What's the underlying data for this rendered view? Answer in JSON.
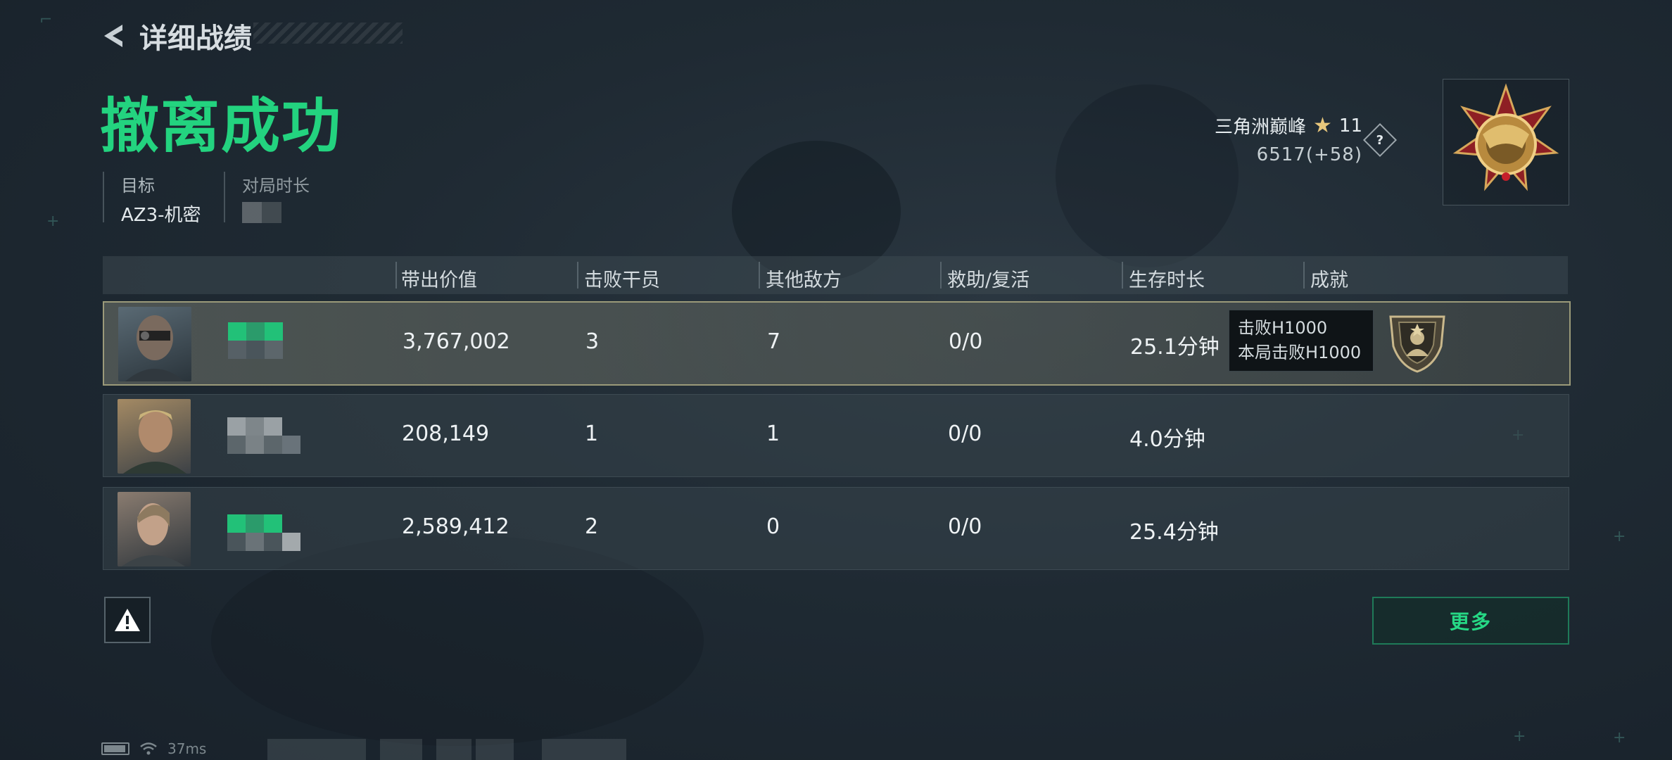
{
  "header": {
    "back_title": "详细战绩"
  },
  "result_title": "撤离成功",
  "info": {
    "target_label": "目标",
    "target_value": "AZ3-机密",
    "duration_label": "对局时长"
  },
  "rank": {
    "name": "三角洲巅峰",
    "stars": "11",
    "score": "6517(+58)",
    "help": "?"
  },
  "table": {
    "columns": [
      "带出价值",
      "击败干员",
      "其他敌方",
      "救助/复活",
      "生存时长",
      "成就"
    ],
    "rows": [
      {
        "value": "3,767,002",
        "kills": "3",
        "other": "7",
        "assist": "0/0",
        "survive": "25.1分钟",
        "self": true
      },
      {
        "value": "208,149",
        "kills": "1",
        "other": "1",
        "assist": "0/0",
        "survive": "4.0分钟",
        "self": false
      },
      {
        "value": "2,589,412",
        "kills": "2",
        "other": "0",
        "assist": "0/0",
        "survive": "25.4分钟",
        "self": false
      }
    ]
  },
  "tooltip": {
    "line1": "击败H1000",
    "line2": "本局击败H1000"
  },
  "buttons": {
    "more": "更多"
  },
  "status": {
    "ping": "37ms"
  },
  "colors": {
    "accent": "#23d37f",
    "gold": "#e8c77c",
    "row_self_border": "#9b9a79"
  },
  "icons": [
    "back-arrow-icon",
    "star-icon",
    "help-icon",
    "rank-medal-icon",
    "achievement-badge-icon",
    "warning-icon",
    "battery-icon",
    "wifi-icon"
  ]
}
